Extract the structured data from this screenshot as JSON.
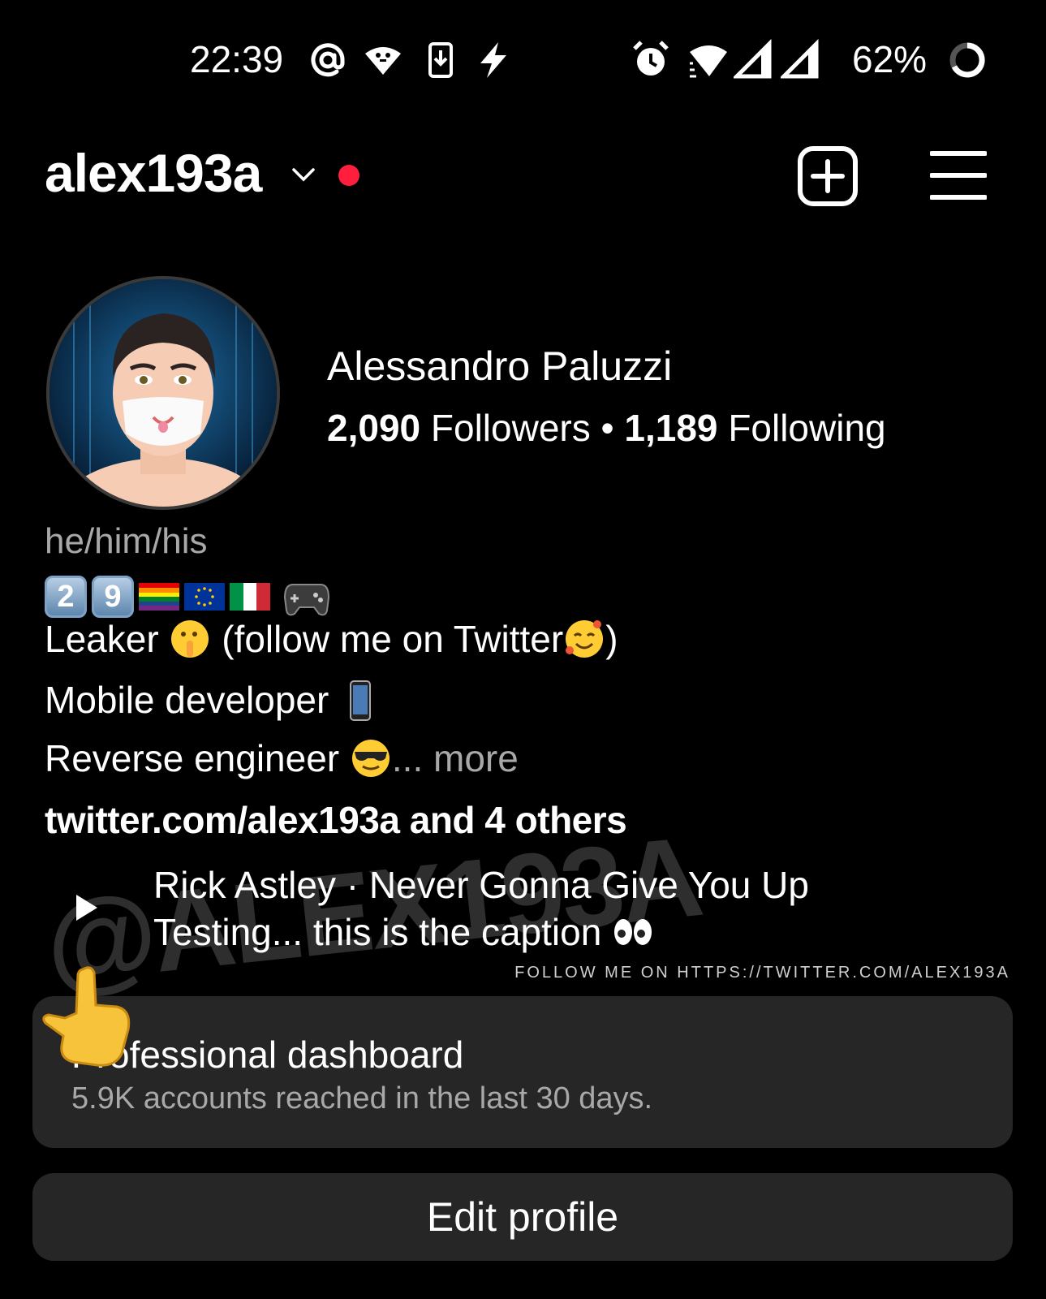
{
  "status_bar": {
    "time": "22:39",
    "battery_percent": "62%",
    "icons": [
      "at-icon",
      "vpn-icon",
      "download-icon",
      "charging-icon",
      "alarm-icon",
      "wifi-icon",
      "signal-icon",
      "signal-icon",
      "battery-ring-icon"
    ]
  },
  "header": {
    "username": "alex193a",
    "icons": [
      "chevron-down-icon",
      "notification-dot",
      "new-post-icon",
      "menu-icon"
    ],
    "dot_color": "#ff1f3d"
  },
  "profile": {
    "full_name": "Alessandro Paluzzi",
    "followers_count": "2,090",
    "followers_label": "Followers",
    "separator": "•",
    "following_count": "1,189",
    "following_label": "Following"
  },
  "bio": {
    "pronouns": "he/him/his",
    "age_digits": [
      "2",
      "9"
    ],
    "emoji_icons": [
      "rainbow-flag-icon",
      "eu-flag-icon",
      "italy-flag-icon",
      "gamepad-icon"
    ],
    "line1_prefix": "Leaker",
    "line1_suffix_open": "(follow me on Twitter",
    "line1_suffix_close": ")",
    "line2": "Mobile developer",
    "line3": "Reverse engineer",
    "more": "... more",
    "link": "twitter.com/alex193a and 4 others"
  },
  "music": {
    "title": "Rick Astley · Never Gonna Give You Up",
    "caption": "Testing... this is the caption"
  },
  "watermark": {
    "large": "@ALEX193A",
    "small": "FOLLOW ME ON HTTPS://TWITTER.COM/ALEX193A"
  },
  "dashboard": {
    "title": "Professional dashboard",
    "subtitle": "5.9K accounts reached in the last 30 days."
  },
  "edit_profile": {
    "label": "Edit profile"
  }
}
